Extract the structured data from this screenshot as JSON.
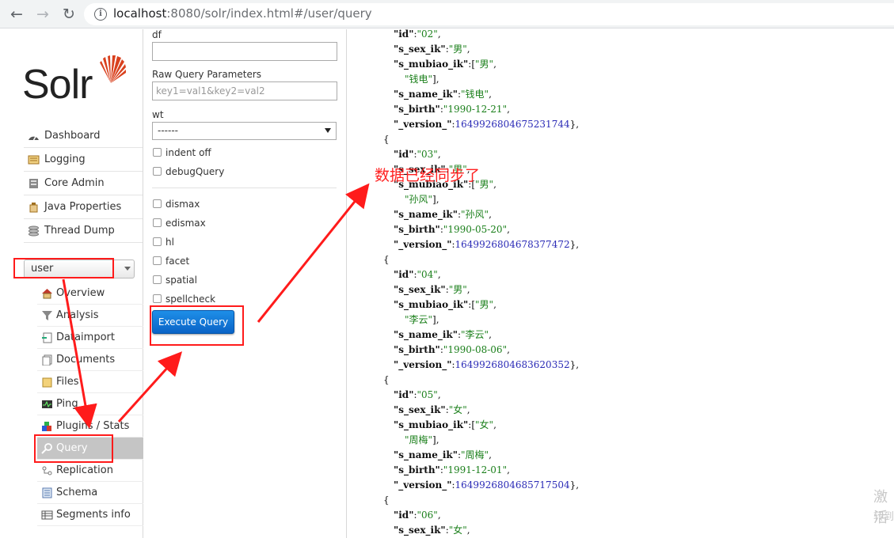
{
  "browser": {
    "url_host": "localhost",
    "url_rest": ":8080/solr/index.html#/user/query"
  },
  "sidebar": {
    "logo": "Solr",
    "menu": [
      {
        "label": "Dashboard",
        "icon": "dashboard-icon"
      },
      {
        "label": "Logging",
        "icon": "logging-icon"
      },
      {
        "label": "Core Admin",
        "icon": "core-admin-icon"
      },
      {
        "label": "Java Properties",
        "icon": "java-icon"
      },
      {
        "label": "Thread Dump",
        "icon": "thread-icon"
      }
    ],
    "core_selector": "user",
    "core_menu": [
      {
        "label": "Overview",
        "icon": "house-icon"
      },
      {
        "label": "Analysis",
        "icon": "funnel-icon"
      },
      {
        "label": "Dataimport",
        "icon": "import-icon"
      },
      {
        "label": "Documents",
        "icon": "documents-icon"
      },
      {
        "label": "Files",
        "icon": "folder-icon"
      },
      {
        "label": "Ping",
        "icon": "ping-icon"
      },
      {
        "label": "Plugins / Stats",
        "icon": "plugins-icon"
      },
      {
        "label": "Query",
        "icon": "magnifier-icon",
        "active": true
      },
      {
        "label": "Replication",
        "icon": "replication-icon"
      },
      {
        "label": "Schema",
        "icon": "schema-icon"
      },
      {
        "label": "Segments info",
        "icon": "segments-icon"
      }
    ]
  },
  "form": {
    "df_label": "df",
    "df_value": "",
    "raw_label": "Raw Query Parameters",
    "raw_placeholder": "key1=val1&key2=val2",
    "wt_label": "wt",
    "wt_value": "------",
    "indent_off": "indent off",
    "debug_query": "debugQuery",
    "dismax": "dismax",
    "edismax": "edismax",
    "hl": "hl",
    "facet": "facet",
    "spatial": "spatial",
    "spellcheck": "spellcheck",
    "execute_label": "Execute Query"
  },
  "results": {
    "docs_partial_top": {
      "id": "02",
      "s_sex_ik": "男",
      "s_mubiao_ik_1": "男",
      "s_mubiao_ik_2": "钱电",
      "s_name_ik": "钱电",
      "s_birth": "1990-12-21",
      "version": "1649926804675231744"
    },
    "docs": [
      {
        "id": "03",
        "s_sex_ik": "男",
        "mubiao1": "男",
        "mubiao2": "孙风",
        "s_name_ik": "孙风",
        "s_birth": "1990-05-20",
        "version": "1649926804678377472"
      },
      {
        "id": "04",
        "s_sex_ik": "男",
        "mubiao1": "男",
        "mubiao2": "李云",
        "s_name_ik": "李云",
        "s_birth": "1990-08-06",
        "version": "1649926804683620352"
      },
      {
        "id": "05",
        "s_sex_ik": "女",
        "mubiao1": "女",
        "mubiao2": "周梅",
        "s_name_ik": "周梅",
        "s_birth": "1991-12-01",
        "version": "1649926804685717504"
      }
    ],
    "doc_partial_bottom": {
      "id": "06",
      "s_sex_ik": "女"
    }
  },
  "annotation": {
    "text": "数据已经同步了"
  },
  "watermark": {
    "line1": "激活",
    "line2": "转到"
  },
  "colors": {
    "annotation_red": "#ff1b1b",
    "execute_blue": "#0a63c6",
    "string_green": "#1a7f1a",
    "number_blue": "#2a2ab6"
  }
}
